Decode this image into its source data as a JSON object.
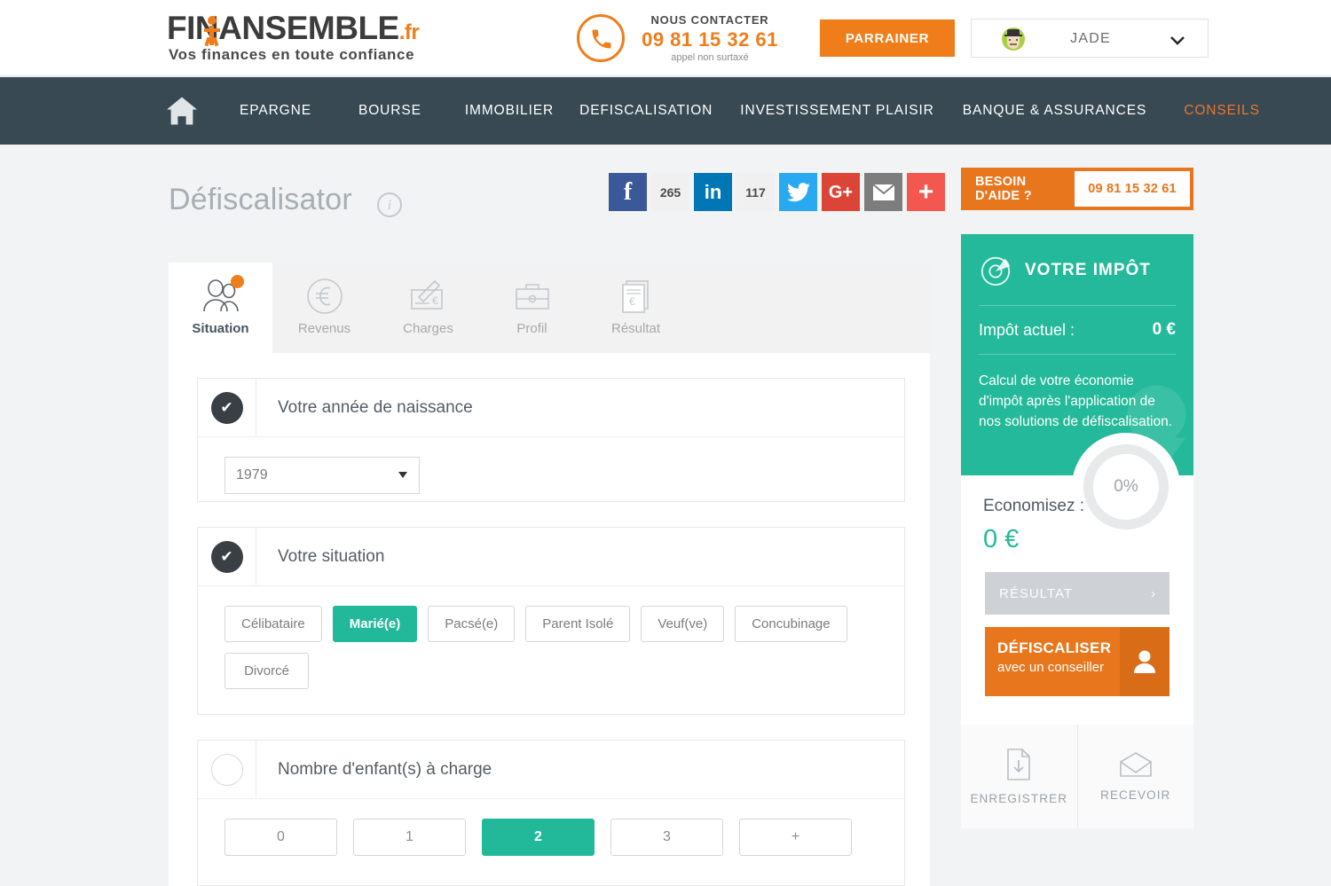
{
  "header": {
    "logo_main": "FINANSEMBLE",
    "logo_domain": ".fr",
    "logo_tagline": "Vos finances en toute confiance",
    "contact_title": "NOUS CONTACTER",
    "contact_number": "09 81 15 32 61",
    "contact_note": "appel non surtaxé",
    "parrainer_label": "PARRAINER",
    "user_name": "JADE"
  },
  "nav": {
    "home_icon": "home-icon",
    "items": [
      {
        "label": "EPARGNE",
        "active": false
      },
      {
        "label": "BOURSE",
        "active": false
      },
      {
        "label": "IMMOBILIER",
        "active": false
      },
      {
        "label": "DEFISCALISATION",
        "active": false
      },
      {
        "label": "INVESTISSEMENT PLAISIR",
        "active": false
      },
      {
        "label": "BANQUE & ASSURANCES",
        "active": false
      },
      {
        "label": "CONSEILS",
        "active": true
      }
    ],
    "accent_color": "#e8772e",
    "bg_color": "#384953"
  },
  "page": {
    "title": "Défiscalisator",
    "info_glyph": "i"
  },
  "share": {
    "facebook_glyph": "f",
    "facebook_count": "265",
    "linkedin_glyph": "in",
    "linkedin_count": "117",
    "twitter_glyph": "twitter-bird",
    "googleplus_glyph": "G+",
    "email_glyph": "envelope",
    "more_glyph": "+"
  },
  "tabs": [
    {
      "label": "Situation",
      "icon": "people-icon",
      "active": true,
      "badge": true
    },
    {
      "label": "Revenus",
      "icon": "euro-circle-icon",
      "active": false,
      "badge": false
    },
    {
      "label": "Charges",
      "icon": "cheque-pen-icon",
      "active": false,
      "badge": false
    },
    {
      "label": "Profil",
      "icon": "briefcase-icon",
      "active": false,
      "badge": false
    },
    {
      "label": "Résultat",
      "icon": "document-euro-icon",
      "active": false,
      "badge": false
    }
  ],
  "sections": {
    "birth_year": {
      "title": "Votre année de naissance",
      "completed": true,
      "selected_value": "1979"
    },
    "situation": {
      "title": "Votre situation",
      "completed": true,
      "options": [
        {
          "label": "Célibataire",
          "selected": false
        },
        {
          "label": "Marié(e)",
          "selected": true
        },
        {
          "label": "Pacsé(e)",
          "selected": false
        },
        {
          "label": "Parent Isolé",
          "selected": false
        },
        {
          "label": "Veuf(ve)",
          "selected": false
        },
        {
          "label": "Concubinage",
          "selected": false
        },
        {
          "label": "Divorcé",
          "selected": false
        }
      ]
    },
    "children": {
      "title": "Nombre d'enfant(s) à charge",
      "completed": false,
      "options": [
        {
          "label": "0",
          "selected": false
        },
        {
          "label": "1",
          "selected": false
        },
        {
          "label": "2",
          "selected": true
        },
        {
          "label": "3",
          "selected": false
        },
        {
          "label": "+",
          "selected": false
        }
      ]
    }
  },
  "sidebar": {
    "help_label": "BESOIN D'AIDE ?",
    "help_phone": "09 81 15 32 61",
    "impot_title": "VOTRE IMPÔT",
    "impot_actuel_label": "Impôt actuel :",
    "impot_actuel_value": "0 €",
    "impot_description": "Calcul de votre économie d'impôt après l'application de nos solutions de défiscalisation.",
    "progress_percent": "0%",
    "economisez_label": "Economisez :",
    "economisez_value": "0 €",
    "resultat_label": "RÉSULTAT",
    "resultat_chevron": "›",
    "defiscaliser_line1": "DÉFISCALISER",
    "defiscaliser_line2": "avec un conseiller",
    "save_label": "ENREGISTRER",
    "receive_label": "RECEVOIR"
  },
  "colors": {
    "brand_orange": "#ef7d1a",
    "nav_dark": "#384953",
    "accent_green": "#23b99a",
    "page_bg": "#f2f3f4"
  }
}
